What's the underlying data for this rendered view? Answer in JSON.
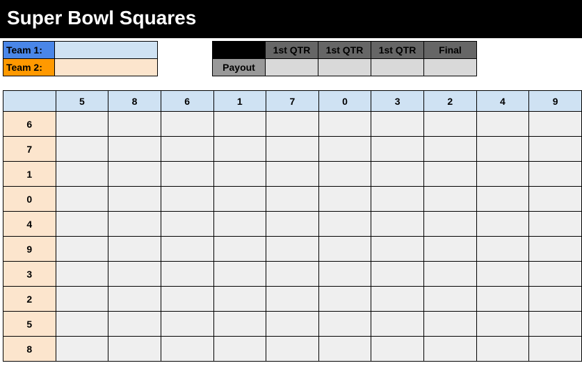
{
  "title": "Super Bowl Squares",
  "teams": {
    "team1_label": "Team 1:",
    "team1_value": "",
    "team2_label": "Team 2:",
    "team2_value": ""
  },
  "payout": {
    "headers": [
      "1st QTR",
      "1st QTR",
      "1st QTR",
      "Final"
    ],
    "label": "Payout",
    "values": [
      "",
      "",
      "",
      ""
    ]
  },
  "grid": {
    "col_numbers": [
      "5",
      "8",
      "6",
      "1",
      "7",
      "0",
      "3",
      "2",
      "4",
      "9"
    ],
    "row_numbers": [
      "6",
      "7",
      "1",
      "0",
      "4",
      "9",
      "3",
      "2",
      "5",
      "8"
    ]
  }
}
